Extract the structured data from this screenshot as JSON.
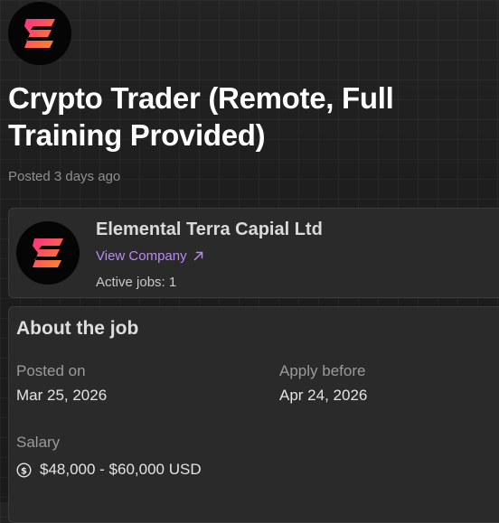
{
  "header": {
    "logo_icon": "company-logo-icon"
  },
  "job": {
    "title": "Crypto Trader (Remote, Full Training Provided)",
    "posted_ago": "Posted 3 days ago"
  },
  "company": {
    "name": "Elemental Terra Capial Ltd",
    "view_company_label": "View Company",
    "view_company_icon": "external-link-arrow-icon",
    "active_jobs": "Active jobs: 1",
    "logo_icon": "company-logo-icon"
  },
  "about": {
    "heading": "About the job",
    "posted_on_label": "Posted on",
    "posted_on_value": "Mar 25, 2026",
    "apply_before_label": "Apply before",
    "apply_before_value": "Apr 24, 2026",
    "salary_label": "Salary",
    "salary_value": "$48,000 - $60,000 USD",
    "salary_icon": "dollar-circle-icon"
  },
  "colors": {
    "background": "#1b1b1b",
    "card": "#2a2a2a",
    "link": "#b98af4",
    "logo_gradient_start": "#ff2d87",
    "logo_gradient_end": "#ff8a1f"
  }
}
